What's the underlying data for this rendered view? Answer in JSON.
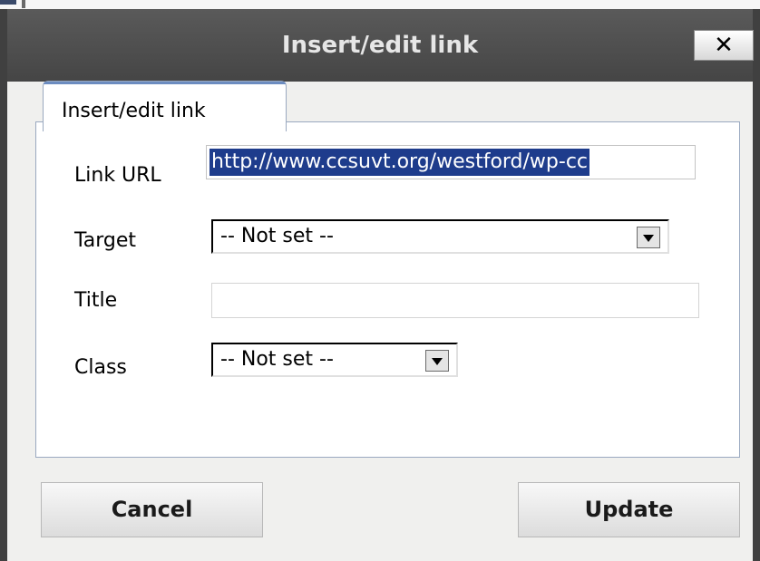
{
  "dialog": {
    "title": "Insert/edit link",
    "close_label": "✕"
  },
  "tabs": [
    {
      "label": "Insert/edit link"
    }
  ],
  "form": {
    "url_label": "Link URL",
    "url_value": "http://www.ccsuvt.org/westford/wp-cc",
    "target_label": "Target",
    "target_value": "-- Not set --",
    "title_label": "Title",
    "title_value": "",
    "class_label": "Class",
    "class_value": "-- Not set --"
  },
  "buttons": {
    "cancel": "Cancel",
    "update": "Update"
  },
  "colors": {
    "titlebar": "#454545",
    "selection": "#1e3c8c",
    "panel_border": "#9aa9c0"
  },
  "icons": {
    "close": "close-icon",
    "dropdown": "chevron-down-icon"
  }
}
